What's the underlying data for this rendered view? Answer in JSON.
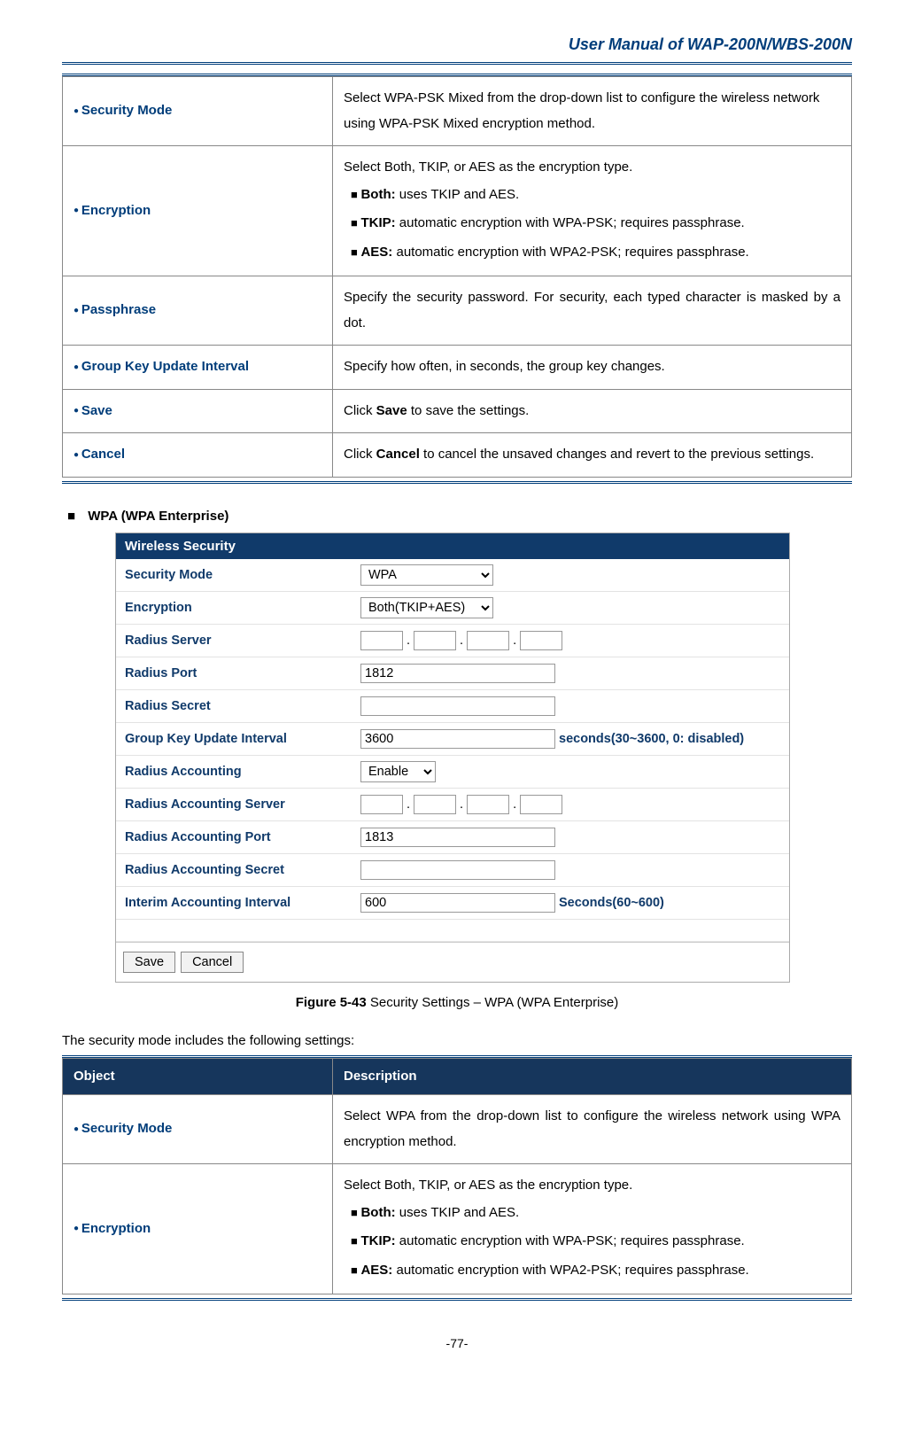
{
  "header": {
    "title": "User Manual of WAP-200N/WBS-200N"
  },
  "table1": {
    "rows": [
      {
        "obj": "Security Mode",
        "desc": "Select WPA-PSK Mixed from the drop-down list to configure the wireless network using WPA-PSK Mixed encryption method."
      },
      {
        "obj": "Encryption",
        "desc_lead": "Select Both, TKIP, or AES as the encryption type.",
        "items": [
          {
            "b": "Both:",
            "t": " uses TKIP and AES."
          },
          {
            "b": "TKIP:",
            "t": " automatic encryption with WPA-PSK; requires passphrase."
          },
          {
            "b": "AES:",
            "t": " automatic encryption with WPA2-PSK; requires passphrase."
          }
        ]
      },
      {
        "obj": "Passphrase",
        "desc": "Specify the security password. For security, each typed character is masked by a dot."
      },
      {
        "obj": "Group Key Update Interval",
        "desc": "Specify how often, in seconds, the group key changes."
      },
      {
        "obj": "Save",
        "desc_pre": "Click ",
        "desc_b": "Save",
        "desc_post": " to save the settings."
      },
      {
        "obj": "Cancel",
        "desc_pre": "Click ",
        "desc_b": "Cancel",
        "desc_post": " to cancel the unsaved changes and revert to the previous settings."
      }
    ]
  },
  "section_head": "WPA (WPA Enterprise)",
  "figure": {
    "title": "Wireless Security",
    "rows": {
      "security_mode": {
        "label": "Security Mode",
        "value": "WPA"
      },
      "encryption": {
        "label": "Encryption",
        "value": "Both(TKIP+AES)"
      },
      "radius_server": {
        "label": "Radius Server"
      },
      "radius_port": {
        "label": "Radius Port",
        "value": "1812"
      },
      "radius_secret": {
        "label": "Radius Secret",
        "value": ""
      },
      "gkui": {
        "label": "Group Key Update Interval",
        "value": "3600",
        "suffix": "seconds(30~3600, 0: disabled)"
      },
      "radius_acc": {
        "label": "Radius Accounting",
        "value": "Enable"
      },
      "radius_acc_server": {
        "label": "Radius Accounting Server"
      },
      "radius_acc_port": {
        "label": "Radius Accounting Port",
        "value": "1813"
      },
      "radius_acc_secret": {
        "label": "Radius Accounting Secret",
        "value": ""
      },
      "interim": {
        "label": "Interim Accounting Interval",
        "value": "600",
        "suffix": "Seconds(60~600)"
      }
    },
    "buttons": {
      "save": "Save",
      "cancel": "Cancel"
    }
  },
  "caption": {
    "bold": "Figure 5-43",
    "rest": " Security Settings – WPA (WPA Enterprise)"
  },
  "intro2": "The security mode includes the following settings:",
  "table2": {
    "head": {
      "obj": "Object",
      "desc": "Description"
    },
    "rows": [
      {
        "obj": "Security Mode",
        "desc": "Select WPA from the drop-down list to configure the wireless network using WPA encryption method."
      },
      {
        "obj": "Encryption",
        "desc_lead": "Select Both, TKIP, or AES as the encryption type.",
        "items": [
          {
            "b": "Both:",
            "t": " uses TKIP and AES."
          },
          {
            "b": "TKIP:",
            "t": " automatic encryption with WPA-PSK; requires passphrase."
          },
          {
            "b": "AES:",
            "t": " automatic encryption with WPA2-PSK; requires passphrase."
          }
        ]
      }
    ]
  },
  "footer": {
    "page": "-77-"
  }
}
